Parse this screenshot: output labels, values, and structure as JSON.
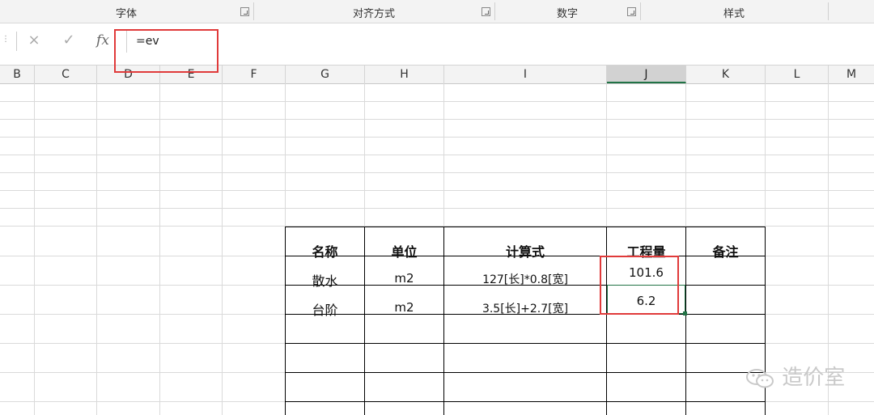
{
  "ribbon": {
    "groups": [
      {
        "label": "字体"
      },
      {
        "label": "对齐方式"
      },
      {
        "label": "数字"
      },
      {
        "label": "样式"
      }
    ]
  },
  "formula_bar": {
    "cancel_icon": "×",
    "enter_icon": "✓",
    "fx_label": "fx",
    "value": "=ev"
  },
  "columns": [
    "B",
    "C",
    "D",
    "E",
    "F",
    "G",
    "H",
    "I",
    "J",
    "K",
    "L",
    "M"
  ],
  "selected_column": "J",
  "table": {
    "headers": [
      "名称",
      "单位",
      "计算式",
      "工程量",
      "备注"
    ],
    "rows": [
      [
        "散水",
        "m2",
        "127[长]*0.8[宽]",
        "101.6",
        ""
      ],
      [
        "台阶",
        "m2",
        "3.5[长]+2.7[宽]",
        "6.2",
        ""
      ]
    ]
  },
  "watermark": {
    "text": "造价室",
    "icon": "wechat-icon"
  },
  "colors": {
    "accent": "#217346",
    "highlight": "#e03a3a"
  }
}
